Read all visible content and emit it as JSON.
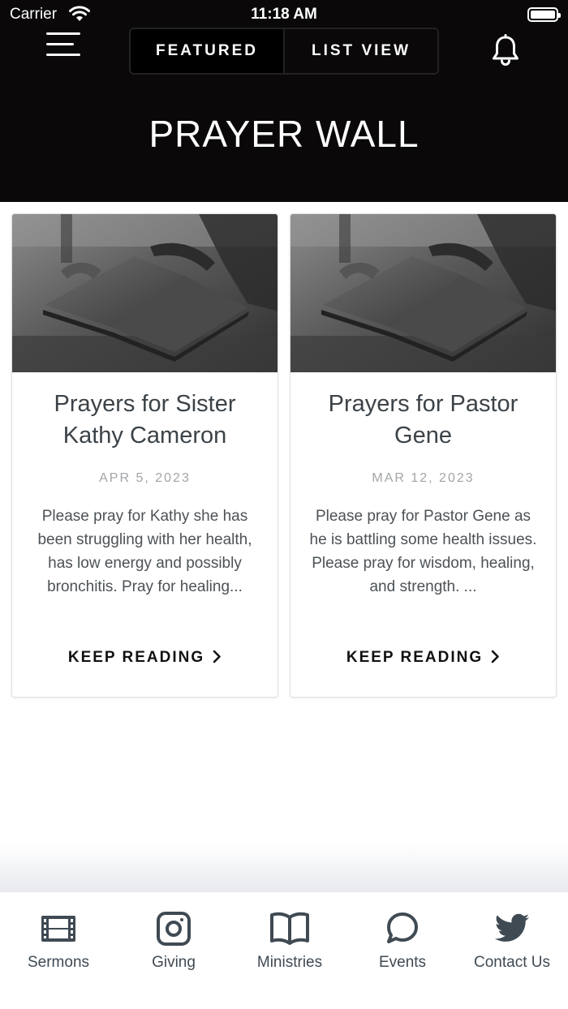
{
  "status_bar": {
    "carrier": "Carrier",
    "time": "11:18 AM"
  },
  "header": {
    "tabs": [
      {
        "label": "FEATURED",
        "active": true
      },
      {
        "label": "LIST VIEW",
        "active": false
      }
    ],
    "title": "PRAYER WALL",
    "background_color": "#0a0808"
  },
  "cards": [
    {
      "title": "Prayers for Sister Kathy Cameron",
      "date": "APR 5, 2023",
      "excerpt": "Please pray for Kathy she has been struggling with her health, has low energy and possibly bronchitis.  Pray for healing...",
      "link_label": "KEEP READING",
      "image_icon": "open-bible-photo"
    },
    {
      "title": "Prayers for Pastor Gene",
      "date": "MAR 12, 2023",
      "excerpt": "Please pray for Pastor Gene as he is battling some health issues.  Please pray for wisdom, healing, and strength.  ...",
      "link_label": "KEEP READING",
      "image_icon": "open-bible-photo"
    }
  ],
  "tabbar": {
    "icon_color": "#3f4a53",
    "items": [
      {
        "label": "Sermons",
        "icon": "film-icon"
      },
      {
        "label": "Giving",
        "icon": "instagram-icon"
      },
      {
        "label": "Ministries",
        "icon": "book-icon"
      },
      {
        "label": "Events",
        "icon": "chat-bubble-icon"
      },
      {
        "label": "Contact Us",
        "icon": "twitter-icon"
      }
    ]
  }
}
